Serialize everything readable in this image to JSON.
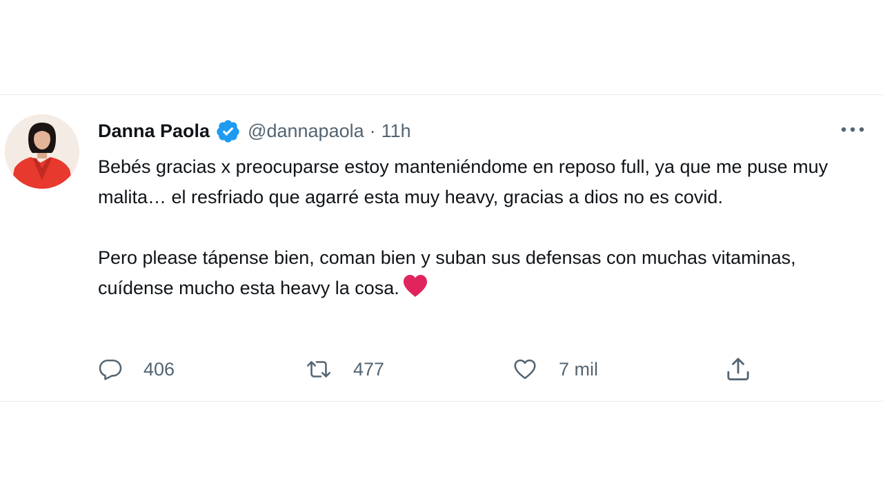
{
  "tweet": {
    "author": {
      "display_name": "Danna Paola",
      "handle": "@dannapaola",
      "verified": true
    },
    "separator": "·",
    "time": "11h",
    "paragraphs": [
      "Bebés gracias x preocuparse estoy manteniéndome en reposo full, ya que me puse muy malita… el resfriado que agarré esta muy heavy, gracias a dios no es covid.",
      "Pero please tápense bien, coman bien y suban sus defensas con muchas vitaminas, cuídense mucho esta heavy la cosa."
    ],
    "emoji": "red-heart",
    "stats": {
      "replies": "406",
      "retweets": "477",
      "likes": "7 mil"
    }
  },
  "icons": {
    "verified": "verified-badge-icon",
    "more": "more-options-icon",
    "reply": "reply-icon",
    "retweet": "retweet-icon",
    "like": "like-icon",
    "share": "share-icon"
  },
  "colors": {
    "text_primary": "#0f1419",
    "text_secondary": "#536471",
    "verified_blue": "#1d9bf0",
    "heart_red": "#e0245e",
    "divider": "#e6ecf0",
    "avatar_red": "#e8392e"
  }
}
